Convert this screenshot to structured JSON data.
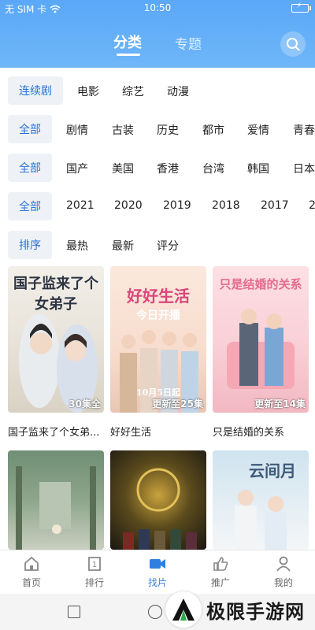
{
  "status_bar": {
    "carrier": "无 SIM 卡",
    "time": "10:50",
    "battery_icon": "battery-charging-icon"
  },
  "header": {
    "tabs": [
      {
        "label": "分类",
        "active": true
      },
      {
        "label": "专题",
        "active": false
      }
    ],
    "search_icon": "search-icon",
    "gradient_color": "#5aa8f7"
  },
  "filters": {
    "type": {
      "chip": "连续剧",
      "options": [
        "电影",
        "综艺",
        "动漫"
      ]
    },
    "genre": {
      "chip": "全部",
      "options": [
        "剧情",
        "古装",
        "历史",
        "都市",
        "爱情",
        "青春"
      ]
    },
    "region": {
      "chip": "全部",
      "options": [
        "国产",
        "美国",
        "香港",
        "台湾",
        "韩国",
        "日本"
      ]
    },
    "year": {
      "chip": "全部",
      "options": [
        "2021",
        "2020",
        "2019",
        "2018",
        "2017",
        "2"
      ]
    },
    "sort": {
      "chip": "排序",
      "options": [
        "最热",
        "最新",
        "评分"
      ]
    }
  },
  "accent_color": "#2b72d6",
  "cards": [
    {
      "title": "国子监来了个女弟...",
      "badge": "30集全",
      "poster_text": "国子监来了个女弟子"
    },
    {
      "title": "好好生活",
      "badge": "更新至25集",
      "poster_text": "好好生活",
      "poster_sub": "今日开播",
      "poster_date": "10月5日起"
    },
    {
      "title": "只是结婚的关系",
      "badge": "更新至14集",
      "poster_text": "只是结婚的关系"
    },
    {
      "title": "",
      "badge": "",
      "poster_text": ""
    },
    {
      "title": "",
      "badge": "",
      "poster_text": ""
    },
    {
      "title": "",
      "badge": "",
      "poster_text": "云间月"
    }
  ],
  "bottom_nav": [
    {
      "label": "首页",
      "icon": "home-icon",
      "active": false
    },
    {
      "label": "排行",
      "icon": "ranking-icon",
      "active": false
    },
    {
      "label": "找片",
      "icon": "video-camera-icon",
      "active": true
    },
    {
      "label": "推广",
      "icon": "thumbs-up-icon",
      "active": false
    },
    {
      "label": "我的",
      "icon": "user-icon",
      "active": false
    }
  ],
  "watermark": {
    "text": "极限手游网"
  }
}
